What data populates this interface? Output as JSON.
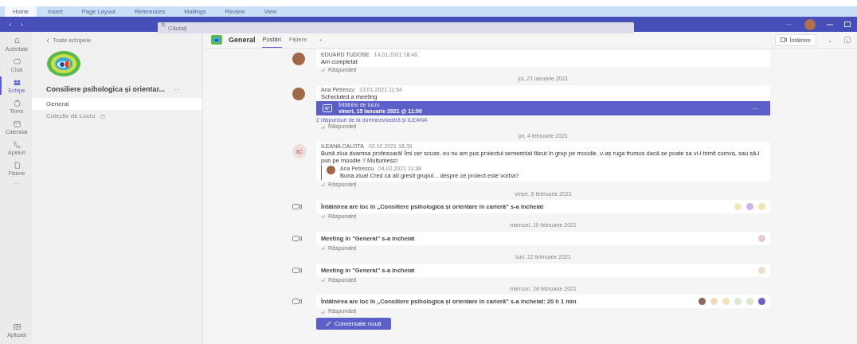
{
  "ribbon": {
    "tabs": [
      {
        "label": "Home",
        "selected": true
      },
      {
        "label": "Insert",
        "selected": false
      },
      {
        "label": "Page Layout",
        "selected": false
      },
      {
        "label": "References",
        "selected": false
      },
      {
        "label": "Mailings",
        "selected": false
      },
      {
        "label": "Review",
        "selected": false
      },
      {
        "label": "View",
        "selected": false
      }
    ]
  },
  "titlebar": {
    "back": "‹",
    "forward": "›",
    "search": {
      "placeholder": "Căutați"
    },
    "more": "···"
  },
  "rail": {
    "items": [
      {
        "label": "Activitate",
        "selected": false
      },
      {
        "label": "Chat",
        "selected": false
      },
      {
        "label": "Echipe",
        "selected": true
      },
      {
        "label": "Teme",
        "selected": false
      },
      {
        "label": "Calendar",
        "selected": false
      },
      {
        "label": "Apeluri",
        "selected": false
      },
      {
        "label": "Fișiere",
        "selected": false
      }
    ],
    "more": "···",
    "apps": "Aplicații"
  },
  "team": {
    "back": "Toate echipele",
    "name": "Consiliere psihologica și orientar...",
    "more": "···",
    "channels": [
      {
        "name": "General",
        "selected": true
      },
      {
        "name": "Colectiv de Lucru",
        "selected": false
      }
    ]
  },
  "channel": {
    "name": "General",
    "tabs": [
      {
        "label": "Postări",
        "selected": true
      },
      {
        "label": "Fișiere",
        "selected": false
      }
    ],
    "add": "+",
    "meet": "Întâlnire",
    "meet_menu": "⌄"
  },
  "feed": [
    {
      "kind": "message",
      "author": "EDUARD TUDOSE",
      "time": "14.01.2021 18:46",
      "text": "Am completat",
      "reply": "Răspundeți"
    },
    {
      "kind": "divider",
      "text": "joi, 21 ianuarie 2021"
    },
    {
      "kind": "message",
      "author": "Ana Petrescu",
      "time": "13.01.2021 11:54",
      "text": "Scheduled a meeting",
      "card": {
        "title": "Întâlnire de lucru",
        "when": "vineri, 15 ianuarie 2021 @ 11:00",
        "more": "···"
      },
      "link": "2 răspunsuri de la dumneavoastră și ILEANA",
      "reply": "Răspundeți"
    },
    {
      "kind": "divider",
      "text": "joi, 4 februarie 2021"
    },
    {
      "kind": "message",
      "author": "ILEANA CALOTA",
      "initials": "IC",
      "time": "02.02.2021 18:39",
      "text": "Bună ziua doamna profesoară! Îmi cer scuze, eu nu am pus proiectul semestrial făcut în grup pe moodle. v-aș ruga frumos dacă se poate sa vi-l trimit cumva, sau să-l pun pe moodle ? Mulțumesc!",
      "replies": [
        {
          "author": "Ana Petrescu",
          "time": "04.02.2021 11:38",
          "text": "Buna ziua! Cred ca ati gresit grupul... despre ce proiect este vorba?"
        }
      ],
      "reply": "Răspundeți"
    },
    {
      "kind": "divider",
      "text": "vineri, 5 februarie 2021"
    },
    {
      "kind": "meeting",
      "text": "Întâlnirea are loc în „Consiliere psihologica și orientare în carieră” s-a încheiat",
      "participants": [
        {
          "color": "#f3e6b8"
        },
        {
          "color": "#c9b8e8"
        },
        {
          "color": "#f0e4b0"
        }
      ],
      "reply": "Răspundeți"
    },
    {
      "kind": "divider",
      "text": "miercuri, 10 februarie 2021"
    },
    {
      "kind": "meeting",
      "text": "Meeting in \"General\" s-a încheiat",
      "participants": [
        {
          "color": "#e8c8d8"
        }
      ],
      "reply": "Răspundeți"
    },
    {
      "kind": "divider",
      "text": "luni, 22 februarie 2021"
    },
    {
      "kind": "meeting",
      "text": "Meeting in \"General\" s-a încheiat",
      "participants": [
        {
          "color": "#f0dcc8"
        }
      ],
      "reply": "Răspundeți"
    },
    {
      "kind": "divider",
      "text": "miercuri, 24 februarie 2021"
    },
    {
      "kind": "meeting",
      "text": "Întâlnirea are loc în „Consiliere psihologica și orientare în carieră” s-a încheiat: 20 h 1 min",
      "participants": [
        {
          "color": "#8a6a5a"
        },
        {
          "color": "#f5d9b8"
        },
        {
          "color": "#f5e0b8"
        },
        {
          "color": "#dce8d0"
        },
        {
          "color": "#d8e8c8"
        },
        {
          "color": "#6b5fc7"
        }
      ],
      "reply": "Răspundeți"
    }
  ],
  "new_conversation": "Conversație nouă"
}
